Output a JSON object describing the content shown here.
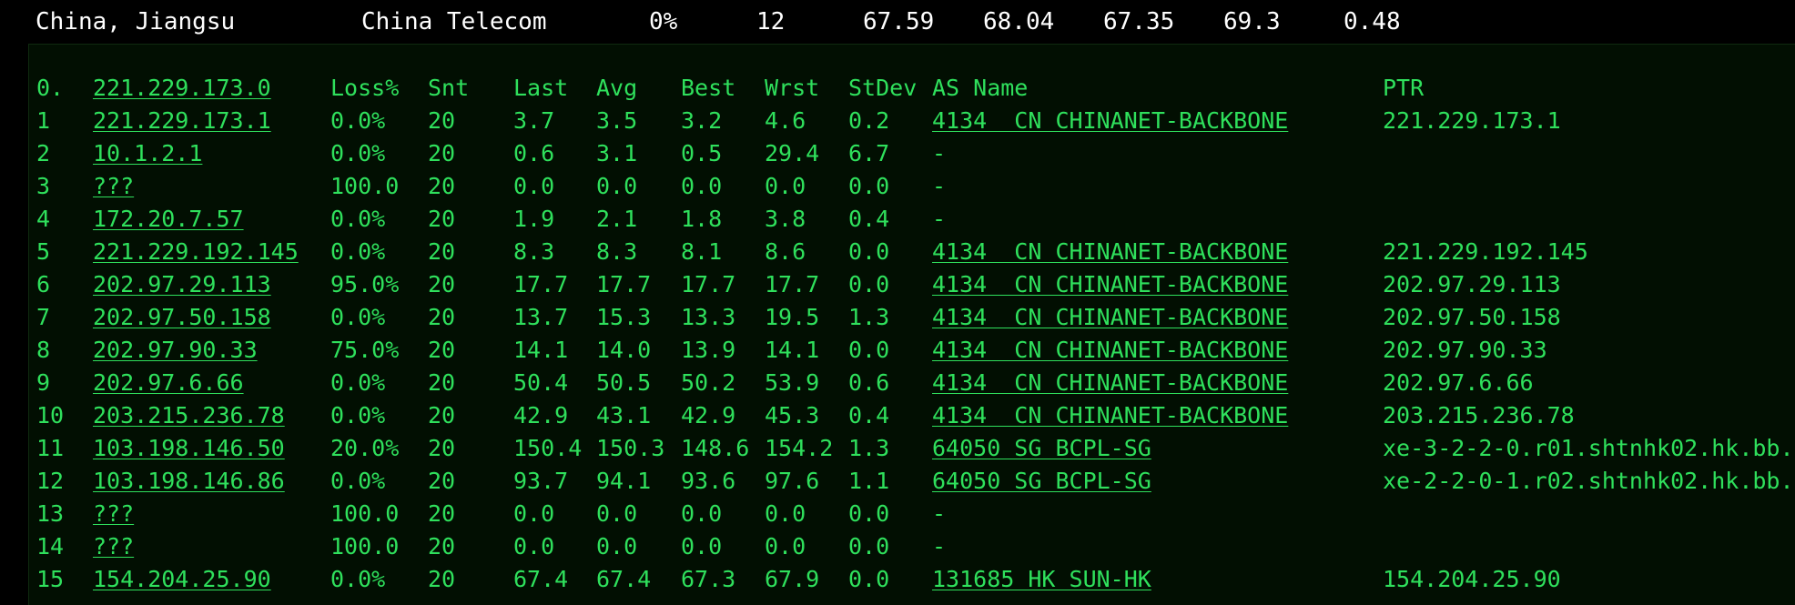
{
  "summary": {
    "location": "China, Jiangsu",
    "isp": "China Telecom",
    "loss": "0%",
    "sent": "12",
    "last": "67.59",
    "avg": "68.04",
    "best": "67.35",
    "worst": "69.3",
    "stdev": "0.48"
  },
  "header": {
    "hop": "0.",
    "host": "221.229.173.0",
    "loss": "Loss%",
    "snt": "Snt",
    "last": "Last",
    "avg": "Avg",
    "best": "Best",
    "wrst": "Wrst",
    "stdev": "StDev",
    "as_name": "AS Name",
    "ptr": "PTR"
  },
  "hops": [
    {
      "hop": "1",
      "host": "221.229.173.1",
      "loss": "0.0%",
      "snt": "20",
      "last": "3.7",
      "avg": "3.5",
      "best": "3.2",
      "wrst": "4.6",
      "stdev": "0.2",
      "as": "4134  CN CHINANET-BACKBONE",
      "ptr": "221.229.173.1"
    },
    {
      "hop": "2",
      "host": "10.1.2.1",
      "loss": "0.0%",
      "snt": "20",
      "last": "0.6",
      "avg": "3.1",
      "best": "0.5",
      "wrst": "29.4",
      "stdev": "6.7",
      "as": "-",
      "ptr": ""
    },
    {
      "hop": "3",
      "host": "???",
      "loss": "100.0",
      "snt": "20",
      "last": "0.0",
      "avg": "0.0",
      "best": "0.0",
      "wrst": "0.0",
      "stdev": "0.0",
      "as": "-",
      "ptr": ""
    },
    {
      "hop": "4",
      "host": "172.20.7.57",
      "loss": "0.0%",
      "snt": "20",
      "last": "1.9",
      "avg": "2.1",
      "best": "1.8",
      "wrst": "3.8",
      "stdev": "0.4",
      "as": "-",
      "ptr": ""
    },
    {
      "hop": "5",
      "host": "221.229.192.145",
      "loss": "0.0%",
      "snt": "20",
      "last": "8.3",
      "avg": "8.3",
      "best": "8.1",
      "wrst": "8.6",
      "stdev": "0.0",
      "as": "4134  CN CHINANET-BACKBONE",
      "ptr": "221.229.192.145"
    },
    {
      "hop": "6",
      "host": "202.97.29.113",
      "loss": "95.0%",
      "snt": "20",
      "last": "17.7",
      "avg": "17.7",
      "best": "17.7",
      "wrst": "17.7",
      "stdev": "0.0",
      "as": "4134  CN CHINANET-BACKBONE",
      "ptr": "202.97.29.113"
    },
    {
      "hop": "7",
      "host": "202.97.50.158",
      "loss": "0.0%",
      "snt": "20",
      "last": "13.7",
      "avg": "15.3",
      "best": "13.3",
      "wrst": "19.5",
      "stdev": "1.3",
      "as": "4134  CN CHINANET-BACKBONE",
      "ptr": "202.97.50.158"
    },
    {
      "hop": "8",
      "host": "202.97.90.33",
      "loss": "75.0%",
      "snt": "20",
      "last": "14.1",
      "avg": "14.0",
      "best": "13.9",
      "wrst": "14.1",
      "stdev": "0.0",
      "as": "4134  CN CHINANET-BACKBONE",
      "ptr": "202.97.90.33"
    },
    {
      "hop": "9",
      "host": "202.97.6.66",
      "loss": "0.0%",
      "snt": "20",
      "last": "50.4",
      "avg": "50.5",
      "best": "50.2",
      "wrst": "53.9",
      "stdev": "0.6",
      "as": "4134  CN CHINANET-BACKBONE",
      "ptr": "202.97.6.66"
    },
    {
      "hop": "10",
      "host": "203.215.236.78",
      "loss": "0.0%",
      "snt": "20",
      "last": "42.9",
      "avg": "43.1",
      "best": "42.9",
      "wrst": "45.3",
      "stdev": "0.4",
      "as": "4134  CN CHINANET-BACKBONE",
      "ptr": "203.215.236.78"
    },
    {
      "hop": "11",
      "host": "103.198.146.50",
      "loss": "20.0%",
      "snt": "20",
      "last": "150.4",
      "avg": "150.3",
      "best": "148.6",
      "wrst": "154.2",
      "stdev": "1.3",
      "as": "64050 SG BCPL-SG",
      "ptr": "xe-3-2-2-0.r01.shtnhk02.hk.bb."
    },
    {
      "hop": "12",
      "host": "103.198.146.86",
      "loss": "0.0%",
      "snt": "20",
      "last": "93.7",
      "avg": "94.1",
      "best": "93.6",
      "wrst": "97.6",
      "stdev": "1.1",
      "as": "64050 SG BCPL-SG",
      "ptr": "xe-2-2-0-1.r02.shtnhk02.hk.bb."
    },
    {
      "hop": "13",
      "host": "???",
      "loss": "100.0",
      "snt": "20",
      "last": "0.0",
      "avg": "0.0",
      "best": "0.0",
      "wrst": "0.0",
      "stdev": "0.0",
      "as": "-",
      "ptr": ""
    },
    {
      "hop": "14",
      "host": "???",
      "loss": "100.0",
      "snt": "20",
      "last": "0.0",
      "avg": "0.0",
      "best": "0.0",
      "wrst": "0.0",
      "stdev": "0.0",
      "as": "-",
      "ptr": ""
    },
    {
      "hop": "15",
      "host": "154.204.25.90",
      "loss": "0.0%",
      "snt": "20",
      "last": "67.4",
      "avg": "67.4",
      "best": "67.3",
      "wrst": "67.9",
      "stdev": "0.0",
      "as": "131685 HK SUN-HK",
      "ptr": "154.204.25.90"
    }
  ]
}
